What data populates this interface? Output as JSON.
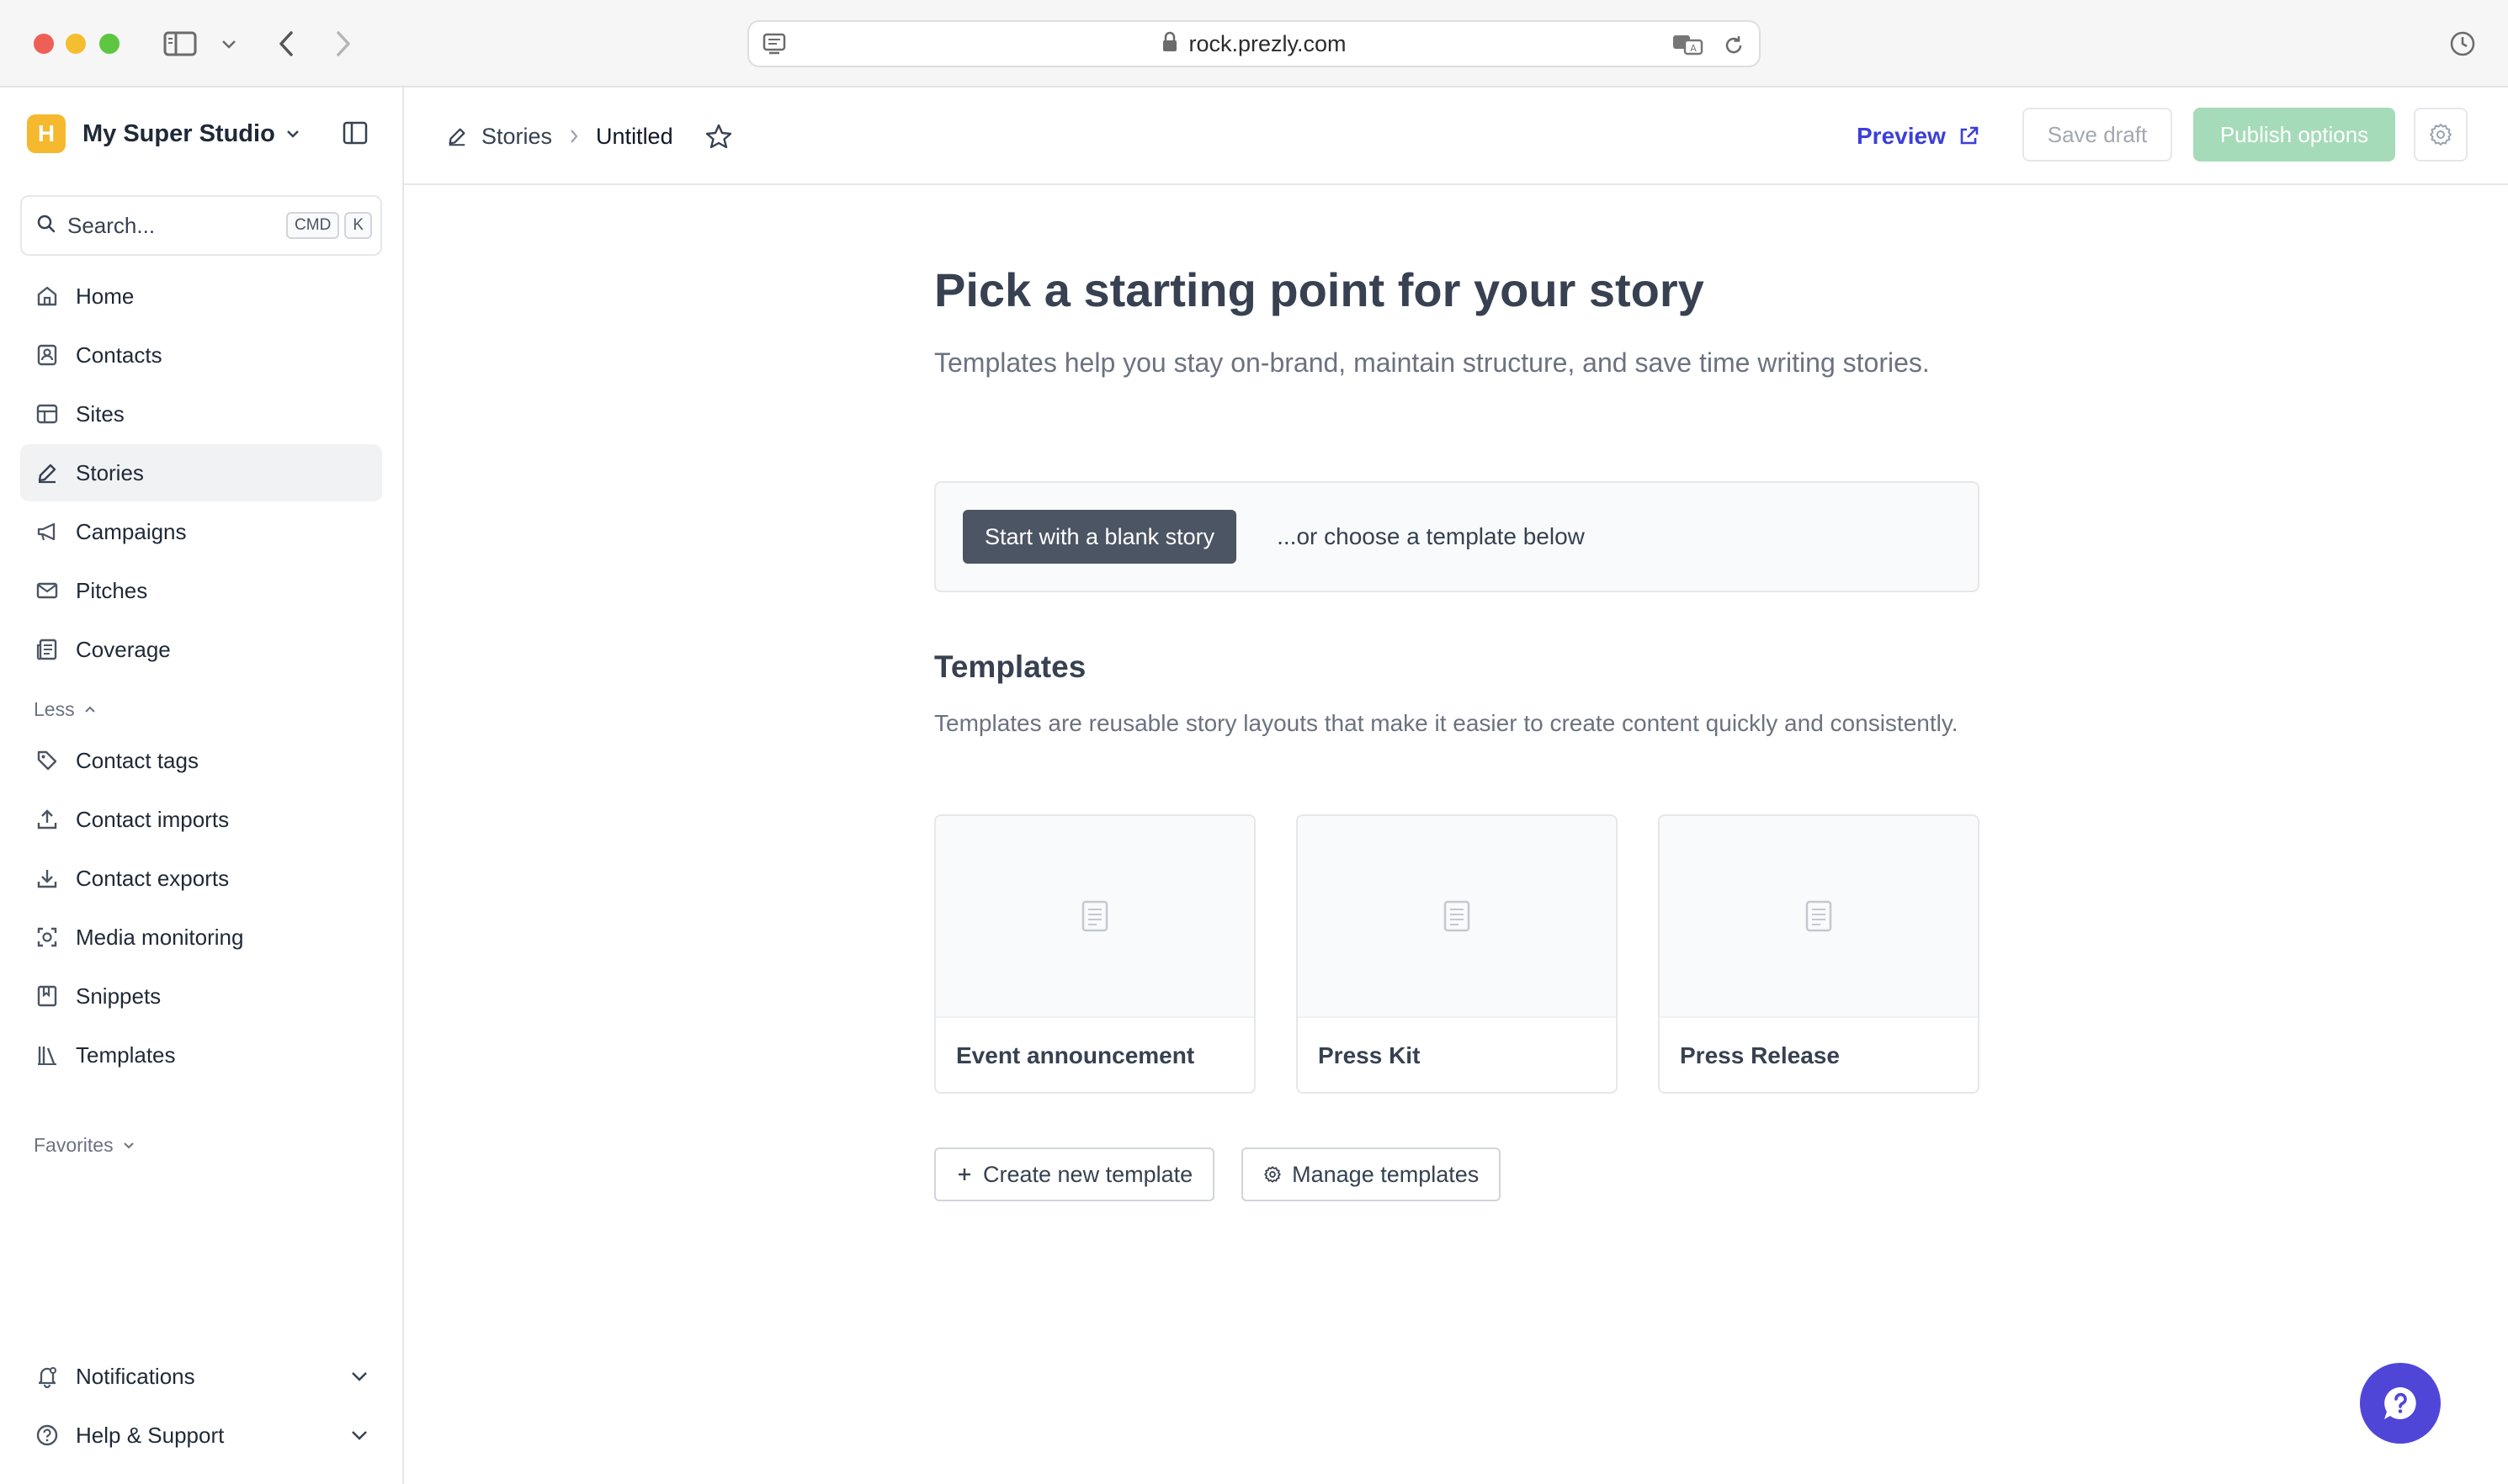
{
  "browser": {
    "url": "rock.prezly.com"
  },
  "sidebar": {
    "workspace_initial": "H",
    "workspace_name": "My Super Studio",
    "search": {
      "placeholder": "Search...",
      "shortcut_keys": [
        "CMD",
        "K"
      ]
    },
    "items": [
      {
        "label": "Home",
        "icon": "home-icon"
      },
      {
        "label": "Contacts",
        "icon": "contacts-icon"
      },
      {
        "label": "Sites",
        "icon": "sites-icon"
      },
      {
        "label": "Stories",
        "icon": "pencil-icon",
        "active": true
      },
      {
        "label": "Campaigns",
        "icon": "megaphone-icon"
      },
      {
        "label": "Pitches",
        "icon": "envelope-icon"
      },
      {
        "label": "Coverage",
        "icon": "newspaper-icon"
      }
    ],
    "less_label": "Less",
    "more_items": [
      {
        "label": "Contact tags",
        "icon": "tag-icon"
      },
      {
        "label": "Contact imports",
        "icon": "upload-icon"
      },
      {
        "label": "Contact exports",
        "icon": "download-icon"
      },
      {
        "label": "Media monitoring",
        "icon": "monitoring-icon"
      },
      {
        "label": "Snippets",
        "icon": "bookmark-icon"
      },
      {
        "label": "Templates",
        "icon": "library-icon"
      }
    ],
    "favorites_label": "Favorites",
    "bottom": {
      "notifications": "Notifications",
      "help": "Help & Support"
    }
  },
  "topbar": {
    "breadcrumb_parent": "Stories",
    "breadcrumb_current": "Untitled",
    "preview_label": "Preview",
    "save_draft_label": "Save draft",
    "publish_label": "Publish options"
  },
  "main": {
    "title": "Pick a starting point for your story",
    "subtitle": "Templates help you stay on-brand, maintain structure, and save time writing stories.",
    "blank_button": "Start with a blank story",
    "or_text": "...or choose a template below",
    "templates_heading": "Templates",
    "templates_description": "Templates are reusable story layouts that make it easier to create content quickly and consistently.",
    "templates": [
      {
        "name": "Event announcement"
      },
      {
        "name": "Press Kit"
      },
      {
        "name": "Press Release"
      }
    ],
    "create_template_label": "Create new template",
    "manage_templates_label": "Manage templates"
  },
  "colors": {
    "accent": "#3b3fd8",
    "publish_disabled": "#a6dbb9",
    "workspace_avatar": "#f5b82e",
    "help_fab": "#4f46d8"
  }
}
